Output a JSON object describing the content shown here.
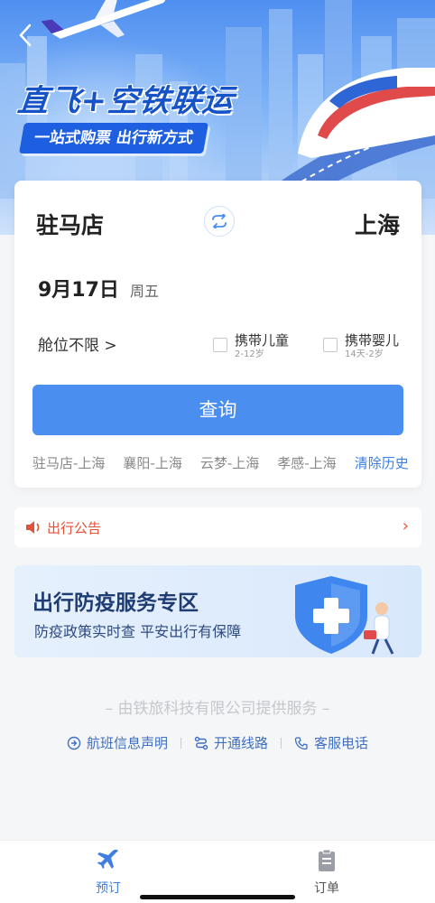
{
  "banner": {
    "title": "直飞+空铁联运",
    "subtitle": "一站式购票 出行新方式"
  },
  "search": {
    "from_city": "驻马店",
    "to_city": "上海",
    "date": "9月17日",
    "weekday": "周五",
    "cabin": "舱位不限 >",
    "child_label": "携带儿童",
    "child_age": "2-12岁",
    "infant_label": "携带婴儿",
    "infant_age": "14天-2岁",
    "search_button": "查询",
    "history": [
      "驻马店-上海",
      "襄阳-上海",
      "云梦-上海",
      "孝感-上海"
    ],
    "clear_history": "清除历史"
  },
  "notice": {
    "text": "出行公告",
    "arrow": "›"
  },
  "epidemic": {
    "title": "出行防疫服务专区",
    "subtitle": "防疫政策实时查 平安出行有保障"
  },
  "footer": {
    "provider": "– 由铁旅科技有限公司提供服务 –",
    "links": [
      "航班信息声明",
      "开通线路",
      "客服电话"
    ]
  },
  "tabs": {
    "book": "预订",
    "order": "订单"
  },
  "colors": {
    "accent": "#4a8ef0",
    "link": "#3e7fe0",
    "notice": "#e0533a",
    "title_blue": "#1553c7"
  }
}
